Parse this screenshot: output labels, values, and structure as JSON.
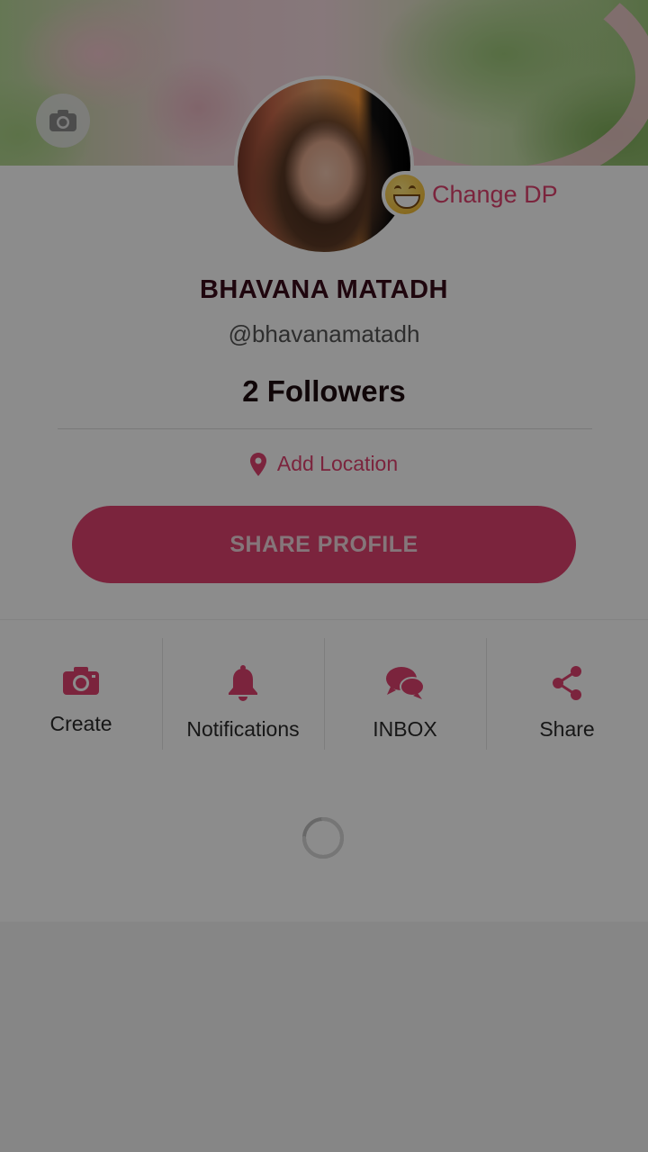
{
  "profile": {
    "name": "BHAVANA MATADH",
    "username": "@bhavanamatadh",
    "followers": "2 Followers",
    "change_dp_label": "Change DP",
    "location_label": "Add Location",
    "share_profile_label": "SHARE PROFILE"
  },
  "actions": [
    {
      "label": "Create",
      "icon": "camera-icon"
    },
    {
      "label": "Notifications",
      "icon": "bell-icon"
    },
    {
      "label": "INBOX",
      "icon": "chat-bubbles-icon"
    },
    {
      "label": "Share",
      "icon": "share-icon"
    }
  ],
  "colors": {
    "accent": "#e0436f",
    "text_dark": "#3a0b1a",
    "overlay": "rgba(0,0,0,0.45)"
  },
  "state": {
    "loading": true
  }
}
